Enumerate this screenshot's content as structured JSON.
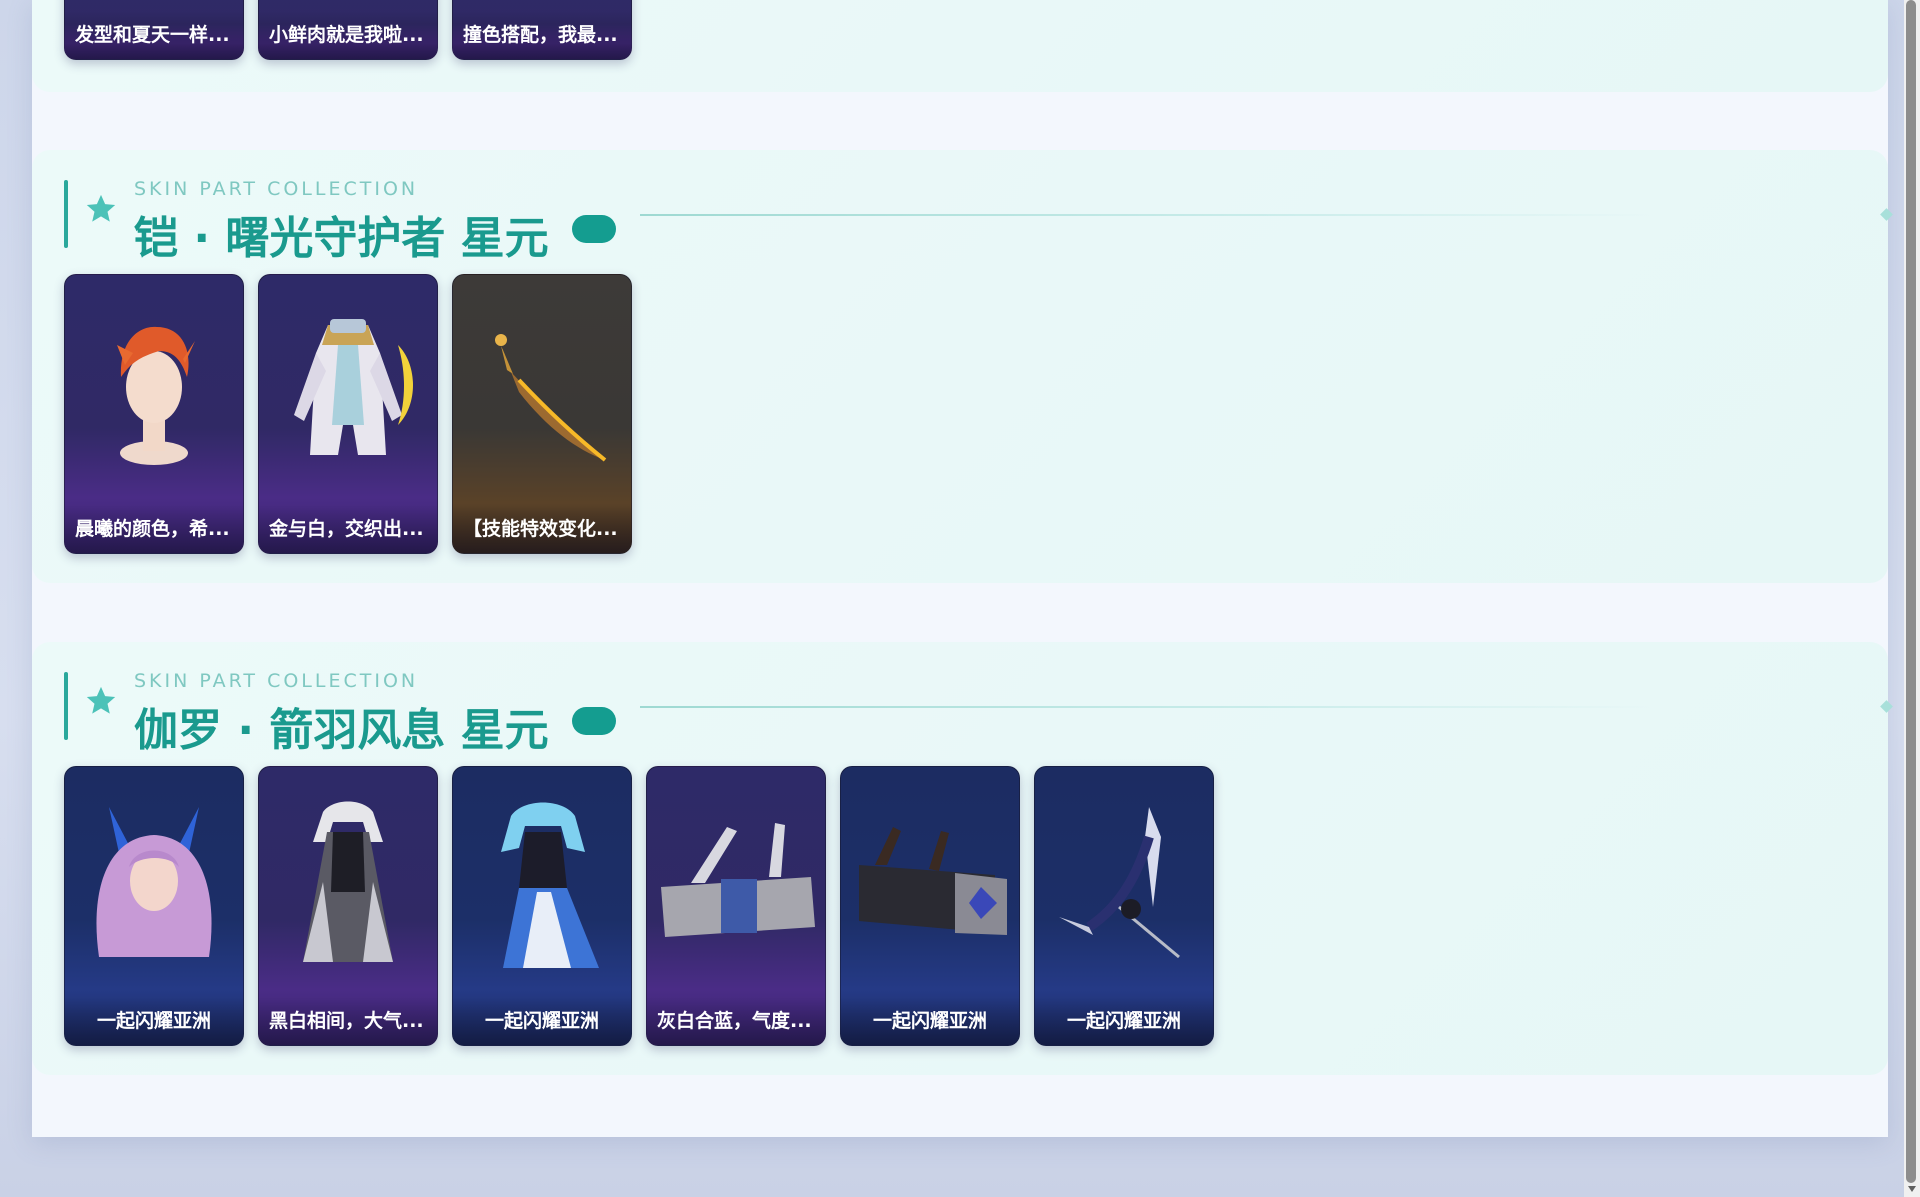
{
  "top_section": {
    "cards": [
      {
        "label": "发型和夏天一样..."
      },
      {
        "label": "小鲜肉就是我啦..."
      },
      {
        "label": "撞色搭配，我最..."
      }
    ]
  },
  "sections": [
    {
      "eyebrow": "SKIN PART COLLECTION",
      "title": "铠 · 曙光守护者 星元",
      "cards": [
        {
          "label": "晨曦的颜色，希...",
          "icon": "hair-head-icon",
          "theme": "purple"
        },
        {
          "label": "金与白，交织出...",
          "icon": "armor-outfit-icon",
          "theme": "purple"
        },
        {
          "label": "【技能特效变化...",
          "icon": "blade-weapon-icon",
          "theme": "brown"
        }
      ]
    },
    {
      "eyebrow": "SKIN PART COLLECTION",
      "title": "伽罗 · 箭羽风息 星元",
      "cards": [
        {
          "label": "一起闪耀亚洲",
          "icon": "hair-head-icon",
          "theme": "navy"
        },
        {
          "label": "黑白相间，大气...",
          "icon": "outfit-icon",
          "theme": "purple"
        },
        {
          "label": "一起闪耀亚洲",
          "icon": "outfit-icon",
          "theme": "navy"
        },
        {
          "label": "灰白合蓝，气度...",
          "icon": "quiver-icon",
          "theme": "purple"
        },
        {
          "label": "一起闪耀亚洲",
          "icon": "quiver-icon",
          "theme": "navy"
        },
        {
          "label": "一起闪耀亚洲",
          "icon": "bow-weapon-icon",
          "theme": "navy"
        }
      ]
    }
  ],
  "colors": {
    "accent": "#1a9a8e",
    "pill": "#149d90",
    "card_purple": "#2e2a68",
    "card_navy": "#1c2c62"
  }
}
